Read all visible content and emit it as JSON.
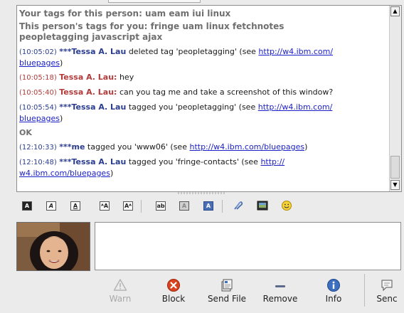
{
  "chat": {
    "your_tags": "Your tags for this person: uam eam iui linux",
    "their_tags_line1": "This person's tags for you: fringe uam linux fetchnotes",
    "their_tags_line2": "peopletagging javascript ajax",
    "messages": [
      {
        "time": "(10:05:02)",
        "nick": "***Tessa A. Lau",
        "text": " deleted tag 'peopletagging' (see ",
        "link1": "http://w4.ibm.com/",
        "link2": "bluepages",
        "tail": ")"
      },
      {
        "time": "(10:05:18)",
        "nick": "Tessa A. Lau:",
        "text": " hey"
      },
      {
        "time": "(10:05:40)",
        "nick": "Tessa A. Lau:",
        "text": " can you tag me and take a screenshot of this window?"
      },
      {
        "time": "(10:05:54)",
        "nick": "***Tessa A. Lau",
        "text": " tagged you 'peopletagging' (see ",
        "link1": "http://w4.ibm.com/",
        "link2": "bluepages",
        "tail": ")"
      },
      {
        "text": "OK"
      },
      {
        "time": "(12:10:33)",
        "nick": "***me",
        "text": " tagged you 'www06' (see ",
        "link1": "http://w4.ibm.com/bluepages",
        "tail": ")"
      },
      {
        "time": "(12:10:48)",
        "nick": "***Tessa A. Lau",
        "text": " tagged you 'fringe-contacts' (see ",
        "link1": "http://",
        "link2": "w4.ibm.com/bluepages",
        "tail": ")"
      }
    ]
  },
  "toolbar": {
    "icons": [
      "bold-icon",
      "italic-icon",
      "underline-icon",
      "font-grow-icon",
      "font-shrink-icon",
      "font-face-icon",
      "foreground-color-icon",
      "background-color-icon",
      "insert-link-icon",
      "insert-image-icon",
      "smiley-icon"
    ]
  },
  "actions": {
    "warn": "Warn",
    "block": "Block",
    "send_file": "Send File",
    "remove": "Remove",
    "info": "Info",
    "send": "Senc"
  },
  "colors": {
    "nick_remote": "#b23a3a",
    "nick_system": "#2b3d8f",
    "link": "#1c21c9",
    "block_red": "#d9431d",
    "info_blue": "#3d6fbf"
  }
}
